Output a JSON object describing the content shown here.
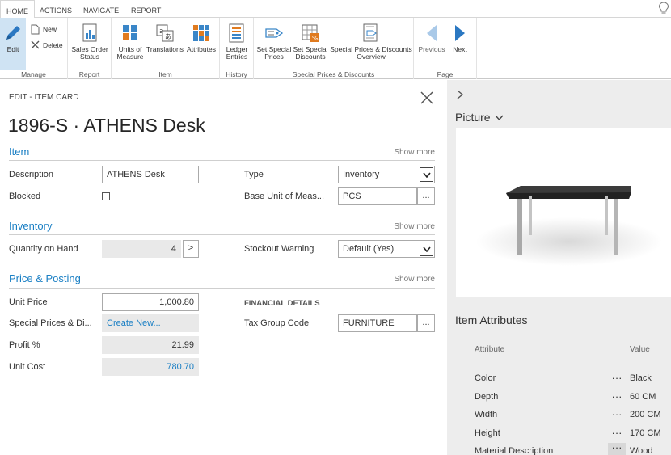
{
  "ribbon": {
    "tabs": [
      {
        "label": "HOME",
        "active": true
      },
      {
        "label": "ACTIONS",
        "active": false
      },
      {
        "label": "NAVIGATE",
        "active": false
      },
      {
        "label": "REPORT",
        "active": false
      }
    ],
    "groups": {
      "manage": {
        "label": "Manage",
        "edit": "Edit",
        "new": "New",
        "delete": "Delete"
      },
      "report": {
        "label": "Report",
        "sales_order_status_1": "Sales Order",
        "sales_order_status_2": "Status"
      },
      "item": {
        "label": "Item",
        "units_1": "Units of",
        "units_2": "Measure",
        "translations": "Translations",
        "attributes": "Attributes"
      },
      "history": {
        "label": "History",
        "ledger_1": "Ledger",
        "ledger_2": "Entries"
      },
      "special": {
        "label": "Special Prices & Discounts",
        "set_prices_1": "Set Special",
        "set_prices_2": "Prices",
        "set_discounts_1": "Set Special",
        "set_discounts_2": "Discounts",
        "overview_1": "Special Prices & Discounts",
        "overview_2": "Overview"
      },
      "page": {
        "label": "Page",
        "previous": "Previous",
        "next": "Next"
      }
    },
    "icons": [
      "edit-icon",
      "new-icon",
      "delete-icon",
      "sales-order-status-icon",
      "units-of-measure-icon",
      "translations-icon",
      "attributes-icon",
      "ledger-entries-icon",
      "set-special-prices-icon",
      "set-special-discounts-icon",
      "special-prices-overview-icon",
      "previous-icon",
      "next-icon",
      "lightbulb-icon"
    ]
  },
  "card": {
    "caption": "EDIT - ITEM CARD",
    "title": "1896-S · ATHENS Desk",
    "sections": {
      "item": {
        "title": "Item",
        "show_more": "Show more",
        "description_label": "Description",
        "description_value": "ATHENS Desk",
        "blocked_label": "Blocked",
        "blocked_checked": false,
        "type_label": "Type",
        "type_value": "Inventory",
        "base_unit_label": "Base Unit of Meas...",
        "base_unit_value": "PCS"
      },
      "inventory": {
        "title": "Inventory",
        "show_more": "Show more",
        "qty_label": "Quantity on Hand",
        "qty_value": "4",
        "qty_button": ">",
        "stockout_label": "Stockout Warning",
        "stockout_value": "Default (Yes)"
      },
      "price": {
        "title": "Price & Posting",
        "show_more": "Show more",
        "unit_price_label": "Unit Price",
        "unit_price_value": "1,000.80",
        "special_label": "Special Prices & Di...",
        "special_value": "Create New...",
        "profit_label": "Profit %",
        "profit_value": "21.99",
        "unit_cost_label": "Unit Cost",
        "unit_cost_value": "780.70",
        "financial_details": "FINANCIAL DETAILS",
        "tax_group_label": "Tax Group Code",
        "tax_group_value": "FURNITURE"
      }
    },
    "ellipsis": "..."
  },
  "factbox": {
    "picture_title": "Picture",
    "attributes_title": "Item Attributes",
    "col_attribute": "Attribute",
    "col_value": "Value",
    "dots": "···",
    "rows": [
      {
        "name": "Color",
        "value": "Black"
      },
      {
        "name": "Depth",
        "value": "60 CM"
      },
      {
        "name": "Width",
        "value": "200 CM"
      },
      {
        "name": "Height",
        "value": "170 CM"
      },
      {
        "name": "Material Description",
        "value": "Wood"
      }
    ]
  },
  "colors": {
    "accent": "#1a7fc4",
    "pane": "#ededed",
    "readonly": "#e9e9e9"
  }
}
